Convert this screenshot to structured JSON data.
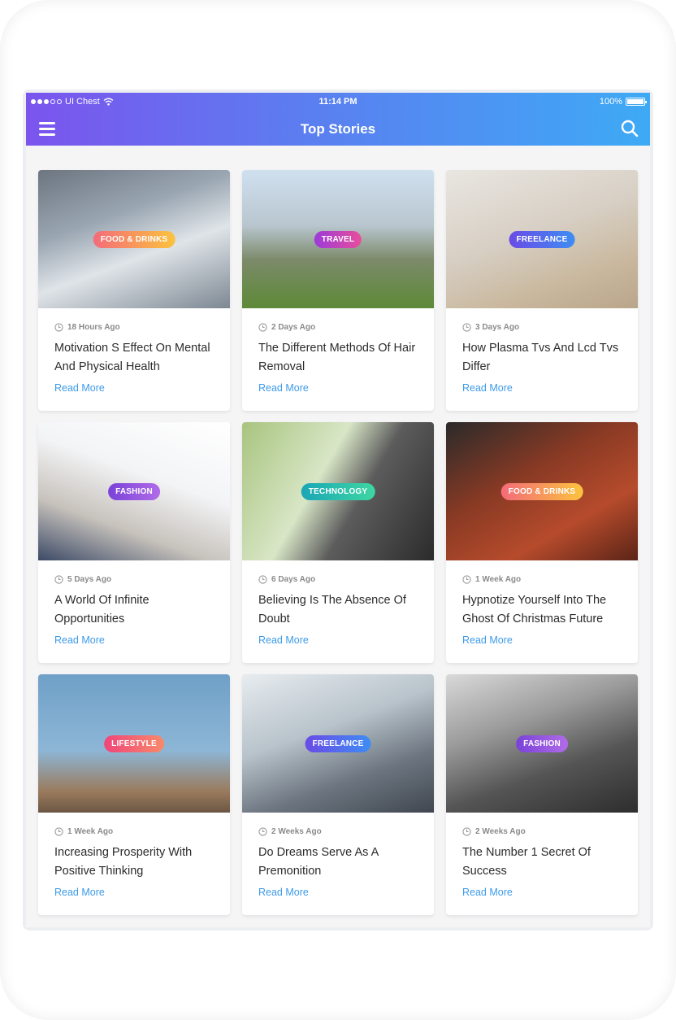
{
  "status_bar": {
    "carrier": "UI Chest",
    "time": "11:14 PM",
    "battery": "100%"
  },
  "header": {
    "title": "Top Stories",
    "menu_icon": "hamburger-menu-icon",
    "search_icon": "search-icon"
  },
  "stories": [
    {
      "tag": "FOOD & DRINKS",
      "tag_colors": [
        "#f46b7a",
        "#fbc33e"
      ],
      "time": "18 Hours Ago",
      "title": "Motivation S Effect On Mental And Physical Health",
      "read_more": "Read More",
      "image": "food-photo"
    },
    {
      "tag": "TRAVEL",
      "tag_colors": [
        "#9b3bd9",
        "#e84e9c"
      ],
      "time": "2 Days Ago",
      "title": "The Different Methods Of Hair Removal",
      "read_more": "Read More",
      "image": "mountain-photo"
    },
    {
      "tag": "FREELANCE",
      "tag_colors": [
        "#6a4be6",
        "#3e8df3"
      ],
      "time": "3 Days Ago",
      "title": "How Plasma Tvs And Lcd Tvs Differ",
      "read_more": "Read More",
      "image": "desk-photo"
    },
    {
      "tag": "FASHION",
      "tag_colors": [
        "#7a42d8",
        "#b06be8"
      ],
      "time": "5 Days Ago",
      "title": "A World Of Infinite Opportunities",
      "read_more": "Read More",
      "image": "portrait-photo"
    },
    {
      "tag": "TECHNOLOGY",
      "tag_colors": [
        "#1aa6b6",
        "#3ed7a2"
      ],
      "time": "6 Days Ago",
      "title": "Believing Is The Absence Of Doubt",
      "read_more": "Read More",
      "image": "camera-photo"
    },
    {
      "tag": "FOOD & DRINKS",
      "tag_colors": [
        "#f46b7a",
        "#fbc33e"
      ],
      "time": "1 Week Ago",
      "title": "Hypnotize Yourself Into The Ghost Of Christmas Future",
      "read_more": "Read More",
      "image": "burger-photo"
    },
    {
      "tag": "LIFESTYLE",
      "tag_colors": [
        "#f0457a",
        "#f78a6a"
      ],
      "time": "1 Week Ago",
      "title": "Increasing Prosperity With Positive Thinking",
      "read_more": "Read More",
      "image": "rooftop-photo"
    },
    {
      "tag": "FREELANCE",
      "tag_colors": [
        "#6a4be6",
        "#3e8df3"
      ],
      "time": "2 Weeks Ago",
      "title": "Do Dreams Serve As A Premonition",
      "read_more": "Read More",
      "image": "laptop-photo"
    },
    {
      "tag": "FASHION",
      "tag_colors": [
        "#7a42d8",
        "#b06be8"
      ],
      "time": "2 Weeks Ago",
      "title": "The Number 1 Secret Of Success",
      "read_more": "Read More",
      "image": "hat-photo"
    }
  ]
}
